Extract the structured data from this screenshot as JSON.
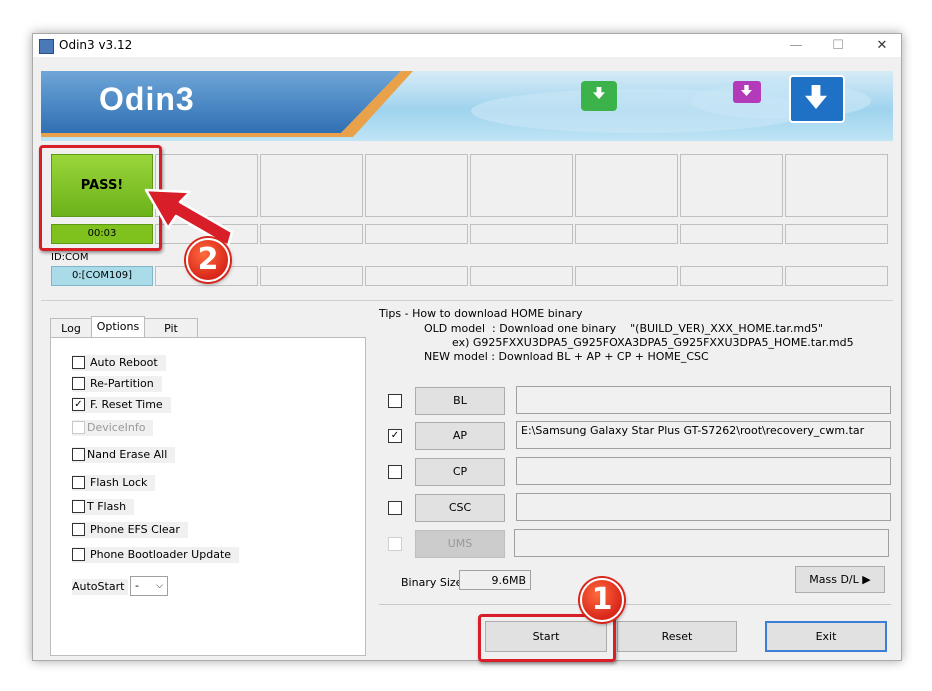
{
  "window": {
    "title": "Odin3 v3.12",
    "controls": {
      "minimize": "—",
      "maximize": "☐",
      "close": "✕"
    }
  },
  "banner": {
    "logo_text": "Odin3"
  },
  "slots": {
    "first_status": "PASS!",
    "first_time": "00:03",
    "id_com_label": "ID:COM",
    "first_port": "0:[COM109]"
  },
  "tabs": [
    {
      "label": "Log"
    },
    {
      "label": "Options"
    },
    {
      "label": "Pit"
    }
  ],
  "options": [
    {
      "label": "Auto Reboot",
      "checked": false,
      "disabled": false
    },
    {
      "label": "Re-Partition",
      "checked": false,
      "disabled": false
    },
    {
      "label": "F. Reset Time",
      "checked": true,
      "disabled": false
    },
    {
      "label": "DeviceInfo",
      "checked": false,
      "disabled": true
    },
    {
      "label": "Nand Erase All",
      "checked": false,
      "disabled": false
    },
    {
      "label": "Flash Lock",
      "checked": false,
      "disabled": false
    },
    {
      "label": "T Flash",
      "checked": false,
      "disabled": false
    },
    {
      "label": "Phone EFS Clear",
      "checked": false,
      "disabled": false
    },
    {
      "label": "Phone Bootloader Update",
      "checked": false,
      "disabled": false
    }
  ],
  "autostart": {
    "label": "AutoStart",
    "value": "-"
  },
  "tips": {
    "title": "Tips - How to download HOME binary",
    "line1": "OLD model  : Download one binary    \"(BUILD_VER)_XXX_HOME.tar.md5\"",
    "line2": "ex) G925FXXU3DPA5_G925FOXA3DPA5_G925FXXU3DPA5_HOME.tar.md5",
    "line3": "NEW model : Download BL + AP + CP + HOME_CSC"
  },
  "files": [
    {
      "button": "BL",
      "path": "",
      "checked": false,
      "disabled": false
    },
    {
      "button": "AP",
      "path": "E:\\Samsung Galaxy Star Plus GT-S7262\\root\\recovery_cwm.tar",
      "checked": true,
      "disabled": false
    },
    {
      "button": "CP",
      "path": "",
      "checked": false,
      "disabled": false
    },
    {
      "button": "CSC",
      "path": "",
      "checked": false,
      "disabled": false
    },
    {
      "button": "UMS",
      "path": "",
      "checked": false,
      "disabled": true
    }
  ],
  "binary_size": {
    "label": "Binary Size",
    "value": "9.6MB"
  },
  "buttons": {
    "mass_dl": "Mass D/L ▶",
    "start": "Start",
    "reset": "Reset",
    "exit": "Exit"
  },
  "annotations": {
    "badge1": "1",
    "badge2": "2"
  },
  "colors": {
    "pass_green": "#7fc21e",
    "com_blue": "#a9dbe8",
    "annotation_red": "#d81e28"
  }
}
